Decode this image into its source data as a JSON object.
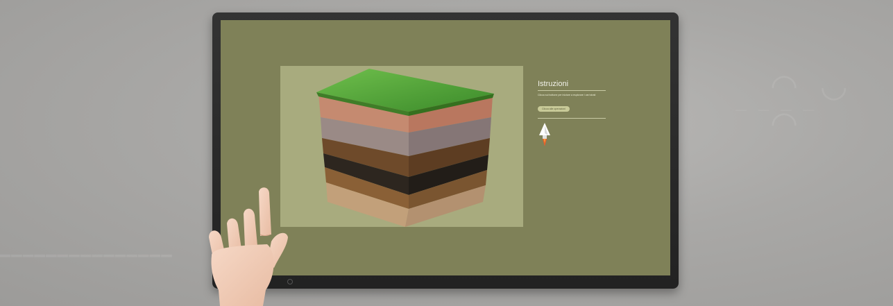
{
  "panel": {
    "title": "Istruzioni",
    "text": "Clicca sul bottone per iniziare a esplorare i vari strati",
    "button_label": "Clicca alle operazioni"
  },
  "icons": {
    "rocket": "rocket-icon"
  },
  "colors": {
    "screen_bg": "#7f8158",
    "image_bg": "#a8ab7e",
    "button_bg": "#c8ca98",
    "grass": "#4f9a3a",
    "bezel": "#2a2a2a"
  }
}
